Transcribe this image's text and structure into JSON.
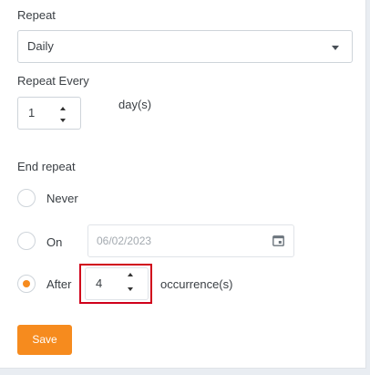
{
  "repeat": {
    "label": "Repeat",
    "selected": "Daily"
  },
  "repeat_every": {
    "label": "Repeat Every",
    "value": "1",
    "unit": "day(s)"
  },
  "end_repeat": {
    "label": "End repeat",
    "options": [
      {
        "label": "Never",
        "checked": false
      },
      {
        "label": "On",
        "checked": false
      },
      {
        "label": "After",
        "checked": true
      }
    ],
    "on_date_placeholder": "06/02/2023",
    "after_value": "4",
    "after_unit": "occurrence(s)"
  },
  "save_label": "Save",
  "colors": {
    "accent": "#f68b1e",
    "highlight": "#d0011b"
  }
}
